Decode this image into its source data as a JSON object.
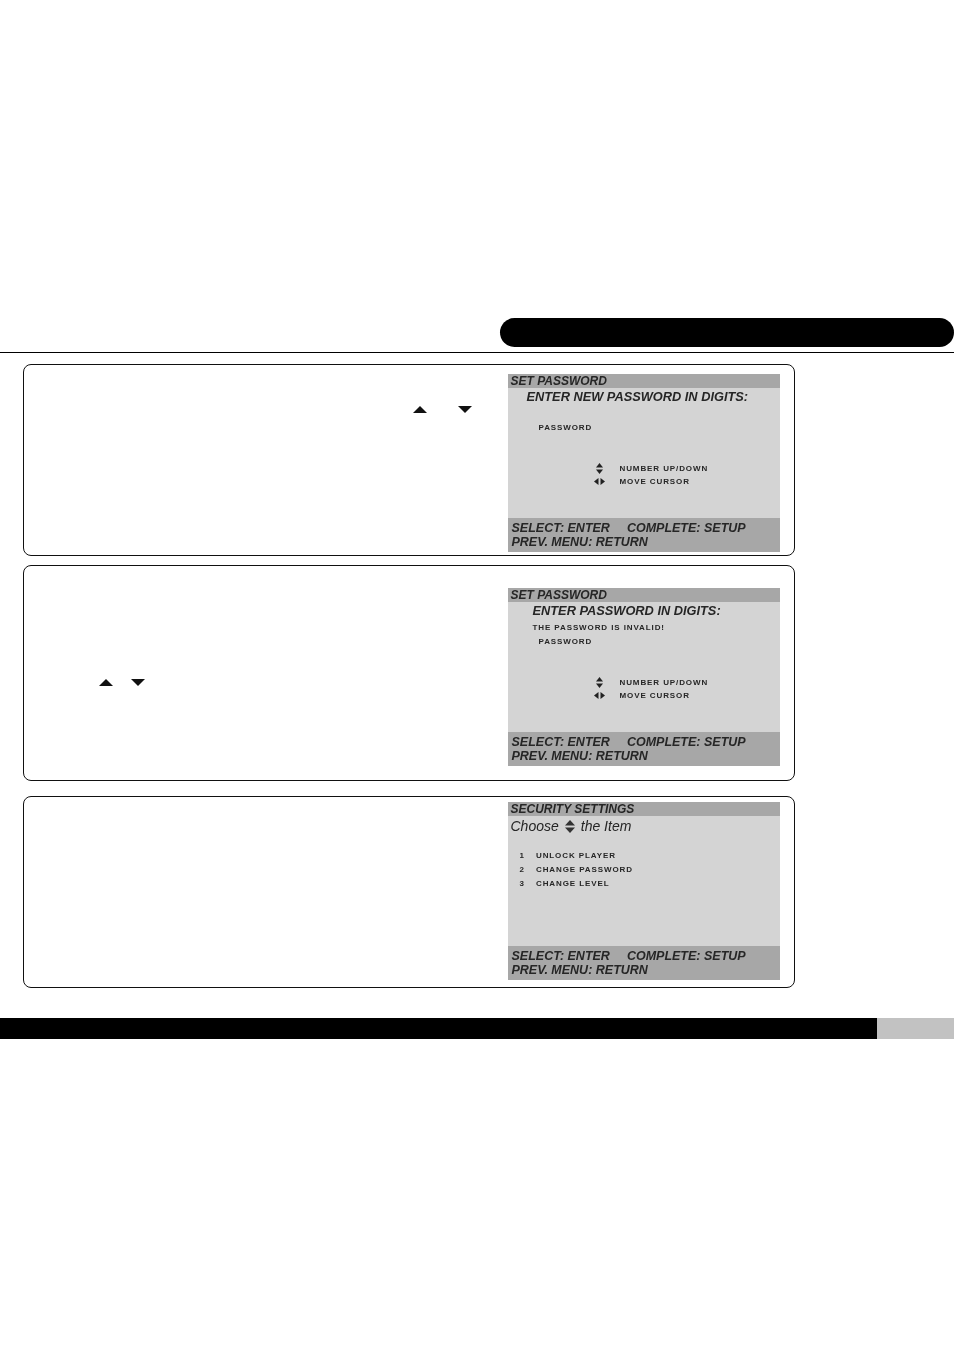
{
  "panels": [
    {
      "screen": {
        "kind": "password",
        "title": "SET PASSWORD",
        "prompt": "ENTER NEW PASSWORD IN DIGITS:",
        "field_label": "PASSWORD",
        "hints": [
          {
            "kind": "up_down",
            "text": "NUMBER UP/DOWN"
          },
          {
            "kind": "left_right",
            "text": "MOVE CURSOR"
          }
        ],
        "footer_lines": [
          [
            "SELECT: ENTER",
            "COMPLETE: SETUP"
          ],
          [
            "PREV. MENU: RETURN"
          ]
        ]
      }
    },
    {
      "screen": {
        "kind": "password",
        "title": "SET PASSWORD",
        "prompt": "ENTER PASSWORD IN DIGITS:",
        "message": "THE PASSWORD IS INVALID!",
        "field_label": "PASSWORD",
        "hints": [
          {
            "kind": "up_down",
            "text": "NUMBER UP/DOWN"
          },
          {
            "kind": "left_right",
            "text": "MOVE CURSOR"
          }
        ],
        "footer_lines": [
          [
            "SELECT: ENTER",
            "COMPLETE: SETUP"
          ],
          [
            "PREV. MENU: RETURN"
          ]
        ]
      }
    },
    {
      "screen": {
        "kind": "menu",
        "title": "SECURITY SETTINGS",
        "prompt": {
          "before": "Choose",
          "after": "the Item"
        },
        "items": [
          {
            "number": "1",
            "label": "UNLOCK PLAYER"
          },
          {
            "number": "2",
            "label": "CHANGE PASSWORD"
          },
          {
            "number": "3",
            "label": "CHANGE LEVEL"
          }
        ],
        "footer_lines": [
          [
            "SELECT: ENTER",
            "COMPLETE: SETUP"
          ],
          [
            "PREV. MENU: RETURN"
          ]
        ]
      }
    }
  ]
}
